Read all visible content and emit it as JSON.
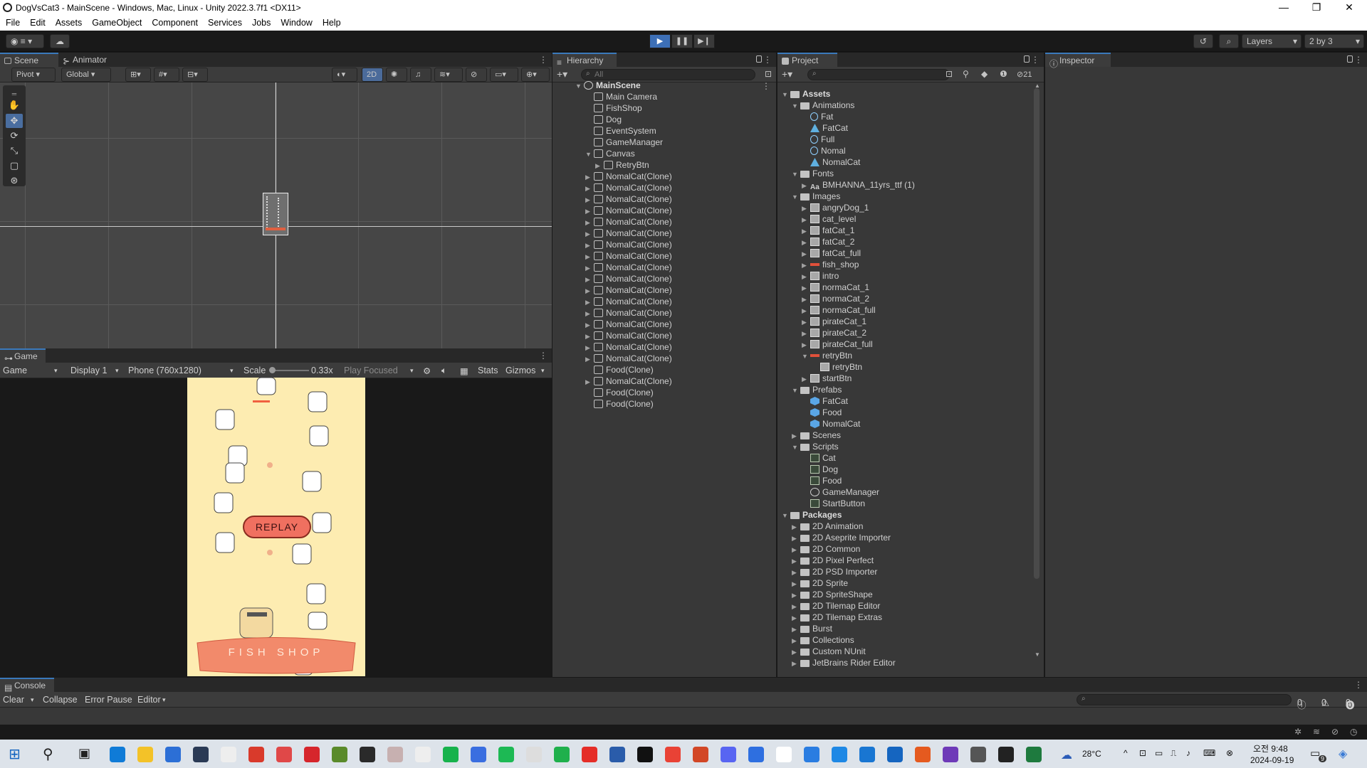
{
  "window": {
    "title": "DogVsCat3 - MainScene - Windows, Mac, Linux - Unity 2022.3.7f1 <DX11>",
    "controls": [
      "—",
      "❐",
      "✕"
    ]
  },
  "menu": [
    "File",
    "Edit",
    "Assets",
    "GameObject",
    "Component",
    "Services",
    "Jobs",
    "Window",
    "Help"
  ],
  "toolbar": {
    "layers_label": "Layers",
    "layout_label": "2 by 3",
    "play": "▶",
    "pause": "❚❚",
    "step": "▶❙"
  },
  "scene_panel": {
    "tabs": [
      "Scene",
      "Animator"
    ],
    "pivot_label": "Pivot",
    "global_label": "Global",
    "mode_2d": "2D"
  },
  "game_panel": {
    "tab": "Game",
    "view_select": "Game",
    "display_select": "Display 1",
    "resolution_select": "Phone (760x1280)",
    "scale_label": "Scale",
    "scale_value": "0.33x",
    "play_mode": "Play Focused",
    "stats_label": "Stats",
    "gizmos_label": "Gizmos",
    "replay_label": "REPLAY",
    "shop_label": "FISH SHOP"
  },
  "hierarchy": {
    "tab": "Hierarchy",
    "search_placeholder": "All",
    "scene_name": "MainScene",
    "items": [
      {
        "label": "Main Camera",
        "depth": 1,
        "arrow": ""
      },
      {
        "label": "FishShop",
        "depth": 1,
        "arrow": ""
      },
      {
        "label": "Dog",
        "depth": 1,
        "arrow": ""
      },
      {
        "label": "EventSystem",
        "depth": 1,
        "arrow": ""
      },
      {
        "label": "GameManager",
        "depth": 1,
        "arrow": ""
      },
      {
        "label": "Canvas",
        "depth": 1,
        "arrow": "▼"
      },
      {
        "label": "RetryBtn",
        "depth": 2,
        "arrow": "▶"
      },
      {
        "label": "NomalCat(Clone)",
        "depth": 1,
        "arrow": "▶"
      },
      {
        "label": "NomalCat(Clone)",
        "depth": 1,
        "arrow": "▶"
      },
      {
        "label": "NomalCat(Clone)",
        "depth": 1,
        "arrow": "▶"
      },
      {
        "label": "NomalCat(Clone)",
        "depth": 1,
        "arrow": "▶"
      },
      {
        "label": "NomalCat(Clone)",
        "depth": 1,
        "arrow": "▶"
      },
      {
        "label": "NomalCat(Clone)",
        "depth": 1,
        "arrow": "▶"
      },
      {
        "label": "NomalCat(Clone)",
        "depth": 1,
        "arrow": "▶"
      },
      {
        "label": "NomalCat(Clone)",
        "depth": 1,
        "arrow": "▶"
      },
      {
        "label": "NomalCat(Clone)",
        "depth": 1,
        "arrow": "▶"
      },
      {
        "label": "NomalCat(Clone)",
        "depth": 1,
        "arrow": "▶"
      },
      {
        "label": "NomalCat(Clone)",
        "depth": 1,
        "arrow": "▶"
      },
      {
        "label": "NomalCat(Clone)",
        "depth": 1,
        "arrow": "▶"
      },
      {
        "label": "NomalCat(Clone)",
        "depth": 1,
        "arrow": "▶"
      },
      {
        "label": "NomalCat(Clone)",
        "depth": 1,
        "arrow": "▶"
      },
      {
        "label": "NomalCat(Clone)",
        "depth": 1,
        "arrow": "▶"
      },
      {
        "label": "NomalCat(Clone)",
        "depth": 1,
        "arrow": "▶"
      },
      {
        "label": "NomalCat(Clone)",
        "depth": 1,
        "arrow": "▶"
      },
      {
        "label": "Food(Clone)",
        "depth": 1,
        "arrow": ""
      },
      {
        "label": "NomalCat(Clone)",
        "depth": 1,
        "arrow": "▶"
      },
      {
        "label": "Food(Clone)",
        "depth": 1,
        "arrow": ""
      },
      {
        "label": "Food(Clone)",
        "depth": 1,
        "arrow": ""
      }
    ]
  },
  "project": {
    "tab": "Project",
    "hidden_count": "21",
    "items": [
      {
        "label": "Assets",
        "depth": 0,
        "arrow": "▼",
        "icon": "folder",
        "bold": true
      },
      {
        "label": "Animations",
        "depth": 1,
        "arrow": "▼",
        "icon": "folder"
      },
      {
        "label": "Fat",
        "depth": 2,
        "arrow": "",
        "icon": "anim"
      },
      {
        "label": "FatCat",
        "depth": 2,
        "arrow": "",
        "icon": "animctl"
      },
      {
        "label": "Full",
        "depth": 2,
        "arrow": "",
        "icon": "anim"
      },
      {
        "label": "Nomal",
        "depth": 2,
        "arrow": "",
        "icon": "anim"
      },
      {
        "label": "NomalCat",
        "depth": 2,
        "arrow": "",
        "icon": "animctl"
      },
      {
        "label": "Fonts",
        "depth": 1,
        "arrow": "▼",
        "icon": "folder"
      },
      {
        "label": "BMHANNA_11yrs_ttf (1)",
        "depth": 2,
        "arrow": "▶",
        "icon": "font"
      },
      {
        "label": "Images",
        "depth": 1,
        "arrow": "▼",
        "icon": "folder"
      },
      {
        "label": "angryDog_1",
        "depth": 2,
        "arrow": "▶",
        "icon": "img"
      },
      {
        "label": "cat_level",
        "depth": 2,
        "arrow": "▶",
        "icon": "img"
      },
      {
        "label": "fatCat_1",
        "depth": 2,
        "arrow": "▶",
        "icon": "img"
      },
      {
        "label": "fatCat_2",
        "depth": 2,
        "arrow": "▶",
        "icon": "img"
      },
      {
        "label": "fatCat_full",
        "depth": 2,
        "arrow": "▶",
        "icon": "img"
      },
      {
        "label": "fish_shop",
        "depth": 2,
        "arrow": "▶",
        "icon": "red"
      },
      {
        "label": "intro",
        "depth": 2,
        "arrow": "▶",
        "icon": "img"
      },
      {
        "label": "normaCat_1",
        "depth": 2,
        "arrow": "▶",
        "icon": "img"
      },
      {
        "label": "normaCat_2",
        "depth": 2,
        "arrow": "▶",
        "icon": "img"
      },
      {
        "label": "normaCat_full",
        "depth": 2,
        "arrow": "▶",
        "icon": "img"
      },
      {
        "label": "pirateCat_1",
        "depth": 2,
        "arrow": "▶",
        "icon": "img"
      },
      {
        "label": "pirateCat_2",
        "depth": 2,
        "arrow": "▶",
        "icon": "img"
      },
      {
        "label": "pirateCat_full",
        "depth": 2,
        "arrow": "▶",
        "icon": "img"
      },
      {
        "label": "retryBtn",
        "depth": 2,
        "arrow": "▼",
        "icon": "red"
      },
      {
        "label": "retryBtn",
        "depth": 3,
        "arrow": "",
        "icon": "img"
      },
      {
        "label": "startBtn",
        "depth": 2,
        "arrow": "▶",
        "icon": "img"
      },
      {
        "label": "Prefabs",
        "depth": 1,
        "arrow": "▼",
        "icon": "folder"
      },
      {
        "label": "FatCat",
        "depth": 2,
        "arrow": "",
        "icon": "prefab"
      },
      {
        "label": "Food",
        "depth": 2,
        "arrow": "",
        "icon": "prefab"
      },
      {
        "label": "NomalCat",
        "depth": 2,
        "arrow": "",
        "icon": "prefab"
      },
      {
        "label": "Scenes",
        "depth": 1,
        "arrow": "▶",
        "icon": "folder"
      },
      {
        "label": "Scripts",
        "depth": 1,
        "arrow": "▼",
        "icon": "folder"
      },
      {
        "label": "Cat",
        "depth": 2,
        "arrow": "",
        "icon": "script"
      },
      {
        "label": "Dog",
        "depth": 2,
        "arrow": "",
        "icon": "script"
      },
      {
        "label": "Food",
        "depth": 2,
        "arrow": "",
        "icon": "script"
      },
      {
        "label": "GameManager",
        "depth": 2,
        "arrow": "",
        "icon": "scene"
      },
      {
        "label": "StartButton",
        "depth": 2,
        "arrow": "",
        "icon": "script"
      },
      {
        "label": "Packages",
        "depth": 0,
        "arrow": "▼",
        "icon": "folder",
        "bold": true
      },
      {
        "label": "2D Animation",
        "depth": 1,
        "arrow": "▶",
        "icon": "folder"
      },
      {
        "label": "2D Aseprite Importer",
        "depth": 1,
        "arrow": "▶",
        "icon": "folder"
      },
      {
        "label": "2D Common",
        "depth": 1,
        "arrow": "▶",
        "icon": "folder"
      },
      {
        "label": "2D Pixel Perfect",
        "depth": 1,
        "arrow": "▶",
        "icon": "folder"
      },
      {
        "label": "2D PSD Importer",
        "depth": 1,
        "arrow": "▶",
        "icon": "folder"
      },
      {
        "label": "2D Sprite",
        "depth": 1,
        "arrow": "▶",
        "icon": "folder"
      },
      {
        "label": "2D SpriteShape",
        "depth": 1,
        "arrow": "▶",
        "icon": "folder"
      },
      {
        "label": "2D Tilemap Editor",
        "depth": 1,
        "arrow": "▶",
        "icon": "folder"
      },
      {
        "label": "2D Tilemap Extras",
        "depth": 1,
        "arrow": "▶",
        "icon": "folder"
      },
      {
        "label": "Burst",
        "depth": 1,
        "arrow": "▶",
        "icon": "folder"
      },
      {
        "label": "Collections",
        "depth": 1,
        "arrow": "▶",
        "icon": "folder"
      },
      {
        "label": "Custom NUnit",
        "depth": 1,
        "arrow": "▶",
        "icon": "folder"
      },
      {
        "label": "JetBrains Rider Editor",
        "depth": 1,
        "arrow": "▶",
        "icon": "folder"
      }
    ]
  },
  "inspector": {
    "tab": "Inspector"
  },
  "console": {
    "tab": "Console",
    "clear_label": "Clear",
    "collapse_label": "Collapse",
    "error_pause_label": "Error Pause",
    "editor_label": "Editor",
    "log_count": "0",
    "warn_count": "0",
    "error_count": "0"
  },
  "taskbar": {
    "weather": "28°C",
    "ampm": "오전 9:48",
    "date": "2024-09-19",
    "notifications": "9"
  },
  "colors": {
    "accent_blue": "#3a79bb",
    "play_active": "#3d6fb6",
    "game_bg": "#fdecb1",
    "replay_red": "#f07060"
  }
}
